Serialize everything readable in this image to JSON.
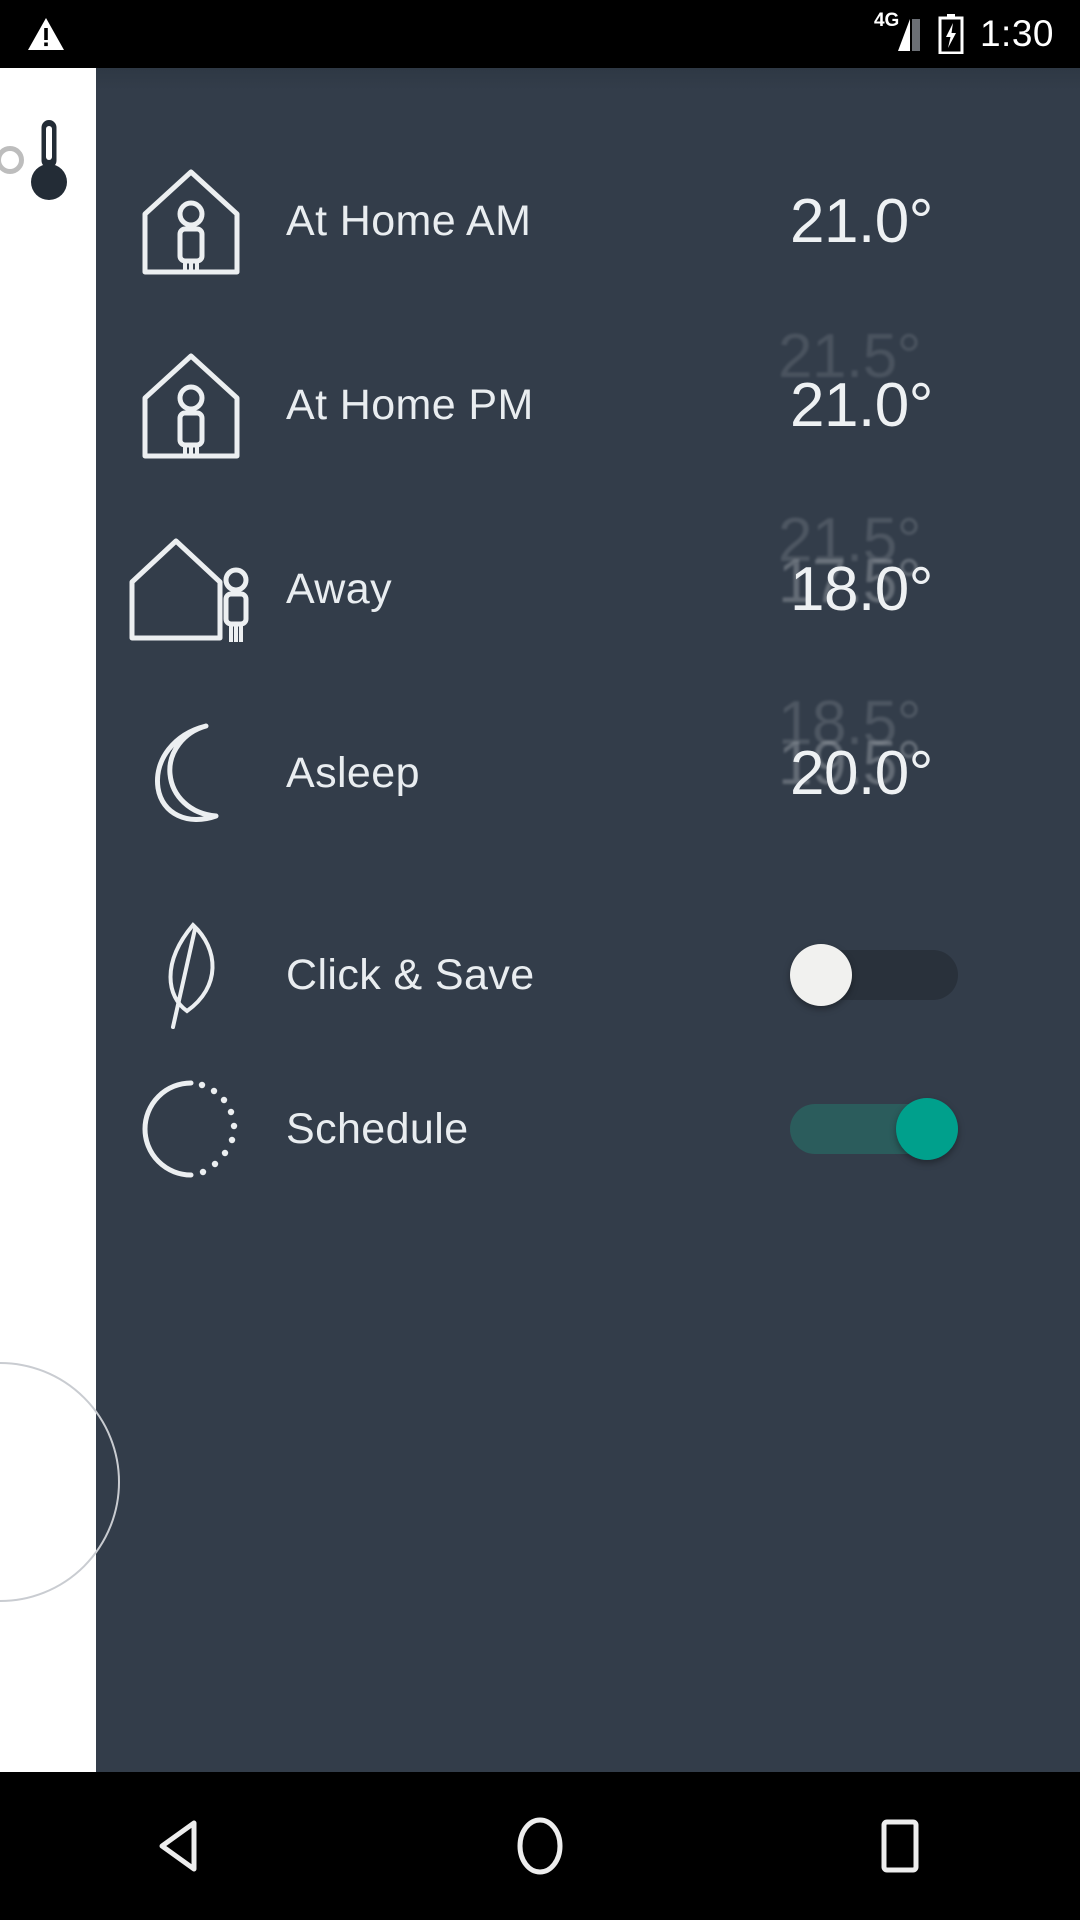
{
  "status_bar": {
    "warning_icon": "warning-triangle-icon",
    "network": "4G",
    "battery_icon": "battery-charging-icon",
    "time": "1:30"
  },
  "sidebar": {
    "thermometer_icon": "thermometer-icon",
    "handle_icon": "circle-handle-icon",
    "dial_icon": "dial-arc-icon"
  },
  "theme": {
    "panel_bg": "#333d4a",
    "rail_bg": "#ffffff",
    "text": "#e9edf0",
    "accent_on": "#00a08c",
    "accent_track": "#2b5c5c",
    "toggle_off_track": "#29313b",
    "toggle_off_knob": "#f1f1ef"
  },
  "main": {
    "schedule_rows": [
      {
        "icon": "house-person-inside-icon",
        "label": "At Home AM",
        "temperature": "21.0°"
      },
      {
        "icon": "house-person-inside-icon",
        "label": "At Home PM",
        "temperature": "21.0°"
      },
      {
        "icon": "house-person-outside-icon",
        "label": "Away",
        "temperature": "18.0°"
      },
      {
        "icon": "crescent-moon-icon",
        "label": "Asleep",
        "temperature": "20.0°"
      }
    ],
    "ghost_values": [
      "21.5°",
      "21.5°",
      "17.5°",
      "18.5°",
      "19.5°"
    ],
    "setting_rows": [
      {
        "icon": "leaf-icon",
        "label": "Click & Save",
        "toggle": "off"
      },
      {
        "icon": "dotted-circle-icon",
        "label": "Schedule",
        "toggle": "on"
      }
    ]
  },
  "nav_bar": {
    "back": "back-triangle-icon",
    "home": "home-circle-icon",
    "recents": "recents-square-icon"
  }
}
